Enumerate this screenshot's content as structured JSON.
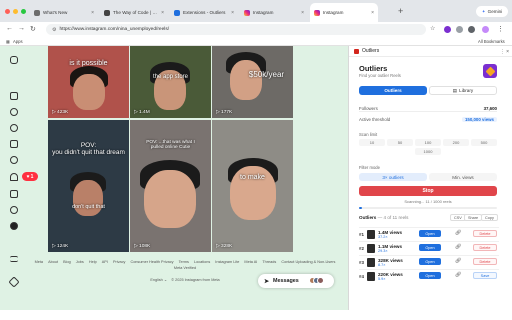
{
  "colors": {
    "accent": "#1f6fde",
    "danger": "#e0454a",
    "instagram_bg": "#dff2e4",
    "notification": "#ff3040",
    "extension_logo": "#7b2fd0"
  },
  "browser": {
    "tabs": [
      {
        "label": "What's New",
        "favicon": "bell-icon",
        "active": false
      },
      {
        "label": "The Way of Code | Rick Rubin",
        "favicon": "page-icon",
        "active": false
      },
      {
        "label": "Extensions - Outliers",
        "favicon": "puzzle-icon",
        "active": false
      },
      {
        "label": "Instagram",
        "favicon": "instagram-icon",
        "active": false
      },
      {
        "label": "Instagram",
        "favicon": "instagram-icon",
        "active": true
      }
    ],
    "gemini_label": "Gemini",
    "url": "https://www.instagram.com/nina_unemployed/reels/",
    "bookmarks": [
      "Apps"
    ],
    "all_bookmarks_label": "All Bookmarks"
  },
  "instagram": {
    "notification_count": "1",
    "reels": [
      {
        "caption": "is it possible",
        "views": "423K"
      },
      {
        "caption": "the app store",
        "views": "1.4M"
      },
      {
        "caption": "$50k/year",
        "views": "177K"
      },
      {
        "caption": "POV:\nyou didn't quit that dream",
        "caption2": "don't quit that",
        "views": "124K"
      },
      {
        "caption": "POV: ...that was what I\npulled online Cutie",
        "views": "108K"
      },
      {
        "caption": "to make",
        "views": "328K"
      }
    ],
    "footer_links": [
      "Meta",
      "About",
      "Blog",
      "Jobs",
      "Help",
      "API",
      "Privacy",
      "Consumer Health Privacy",
      "Terms",
      "Locations",
      "Instagram Lite",
      "Meta AI",
      "Threads",
      "Contact Uploading & Non-Users",
      "Meta Verified"
    ],
    "language": "English",
    "copyright": "© 2025 Instagram from Meta",
    "messages_label": "Messages"
  },
  "extension": {
    "header_name": "Outliers",
    "title": "Outliers",
    "subtitle": "Find your outlier Reels",
    "tab_outliers": "Outliers",
    "tab_library": "Library",
    "followers_label": "Followers",
    "followers_value": "37,600",
    "threshold_label": "Active threshold",
    "threshold_value": "150,000 views",
    "size_label": "Scan limit",
    "size_options": [
      "10",
      "50",
      "100",
      "200",
      "500",
      "1000"
    ],
    "size_option_extra": "1000",
    "mode_label": "Filter mode",
    "mode_option1": "3× outliers",
    "mode_option2": "Min. views",
    "stop_label": "Stop",
    "scan_status": "Scanning... 11 / 1000 reels",
    "scan_progress": 0.011,
    "outliers_label": "Outliers",
    "outliers_count": "— 4 of 11 reels",
    "buttons": {
      "csv": "CSV",
      "share": "Share",
      "copy": "Copy"
    },
    "rows": [
      {
        "rank": "#1",
        "views": "1.4M views",
        "multiplier": "37.2×",
        "open": "Open",
        "action": "Delete",
        "action_type": "delete"
      },
      {
        "rank": "#2",
        "views": "1.1M views",
        "multiplier": "29.3×",
        "open": "Open",
        "action": "Delete",
        "action_type": "delete"
      },
      {
        "rank": "#3",
        "views": "328K views",
        "multiplier": "8.7×",
        "open": "Open",
        "action": "Delete",
        "action_type": "delete"
      },
      {
        "rank": "#4",
        "views": "220K views",
        "multiplier": "5.9×",
        "open": "Open",
        "action": "Save",
        "action_type": "save"
      }
    ]
  }
}
